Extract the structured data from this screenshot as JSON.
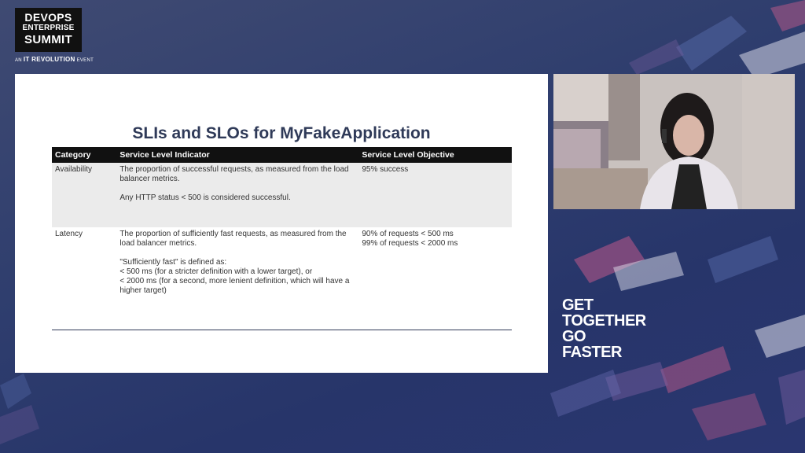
{
  "branding": {
    "logo_line1": "DEVOPS",
    "logo_line2": "ENTERPRISE",
    "logo_line3": "SUMMIT",
    "logo_tag_prefix": "AN",
    "logo_tag_brand": "IT REVOLUTION",
    "logo_tag_suffix": "EVENT"
  },
  "slide": {
    "title": "SLIs and SLOs for MyFakeApplication",
    "headers": [
      "Category",
      "Service Level Indicator",
      "Service Level Objective"
    ],
    "rows": [
      {
        "category": "Availability",
        "sli_p1": "The proportion of successful requests, as measured from the load balancer metrics.",
        "sli_p2": "Any HTTP status < 500 is considered successful.",
        "slo_l1": "95% success",
        "slo_l2": ""
      },
      {
        "category": "Latency",
        "sli_p1": "The proportion of sufficiently fast requests, as measured from the load balancer metrics.",
        "sli_p2_l1": "\"Sufficiently fast\" is defined as:",
        "sli_p2_l2": "< 500 ms (for a stricter definition with a lower target), or",
        "sli_p2_l3": "< 2000 ms (for a second, more lenient definition, which will have a higher target)",
        "slo_l1": "90% of requests < 500 ms",
        "slo_l2": "99% of requests < 2000 ms"
      }
    ]
  },
  "tagline": {
    "line1": "GET",
    "line2": "TOGETHER",
    "line3": "GO",
    "line4": "FASTER"
  },
  "colors": {
    "background": "#2f3e6e",
    "slide_title": "#2f3a58",
    "table_header_bg": "#111111",
    "row_alt_bg": "#ebebeb"
  }
}
